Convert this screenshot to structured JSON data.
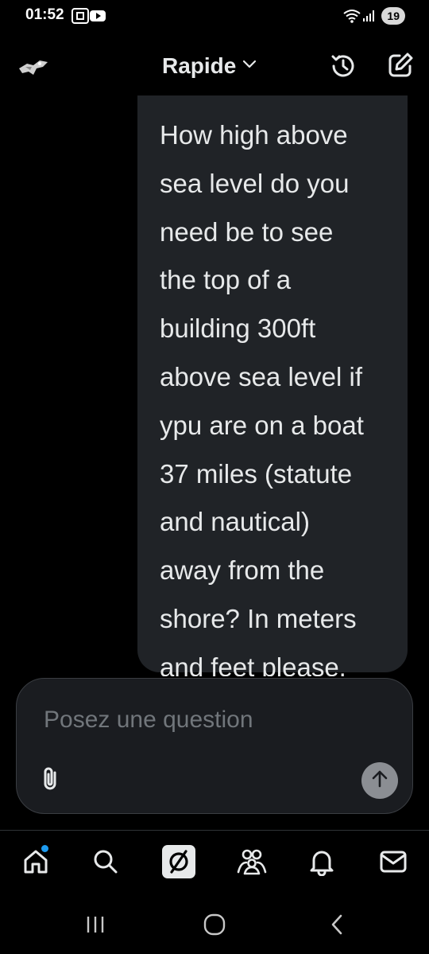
{
  "status_bar": {
    "time": "01:52",
    "battery": "19",
    "icons": [
      "screenshot-icon",
      "youtube-icon",
      "wifi-icon",
      "signal-icon"
    ]
  },
  "header": {
    "model_label": "Rapide",
    "icons": [
      "avatar",
      "chevron-down-icon",
      "history-icon",
      "compose-icon"
    ]
  },
  "chat": {
    "message": "How high above\nsea level do you\nneed be to see\nthe top of a\nbuilding 300ft\nabove sea level if\nypu are on a boat\n37 miles (statute\nand nautical)\naway from the\nshore? In meters\nand feet please."
  },
  "composer": {
    "placeholder": "Posez une question",
    "value": "",
    "icons": [
      "paperclip-icon",
      "arrow-up-icon"
    ]
  },
  "bottom_nav": {
    "items": [
      "home-icon",
      "search-icon",
      "grok-icon",
      "communities-icon",
      "notifications-icon",
      "messages-icon"
    ],
    "active_badge_color": "#1d9bf0"
  },
  "system_nav": {
    "items": [
      "recents-icon",
      "home-circle-icon",
      "back-icon"
    ]
  },
  "colors": {
    "background": "#000000",
    "bubble": "#202327",
    "text": "#e7e9ea",
    "muted": "#71767b"
  }
}
